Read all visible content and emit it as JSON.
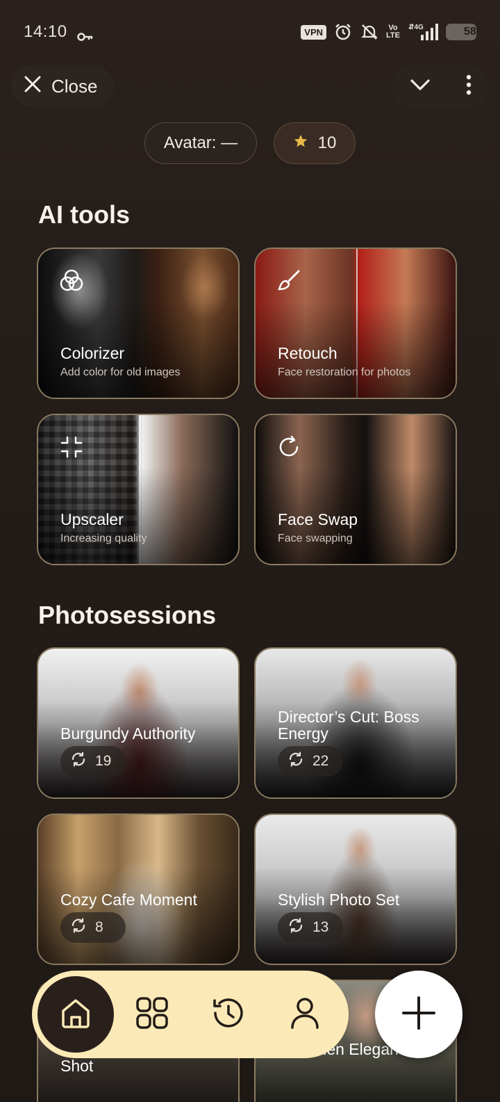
{
  "status_bar": {
    "time": "14:10",
    "vpn": "VPN",
    "volte_top": "Vo",
    "volte_bottom": "LTE",
    "network": "4G",
    "battery": "58"
  },
  "header": {
    "close_label": "Close",
    "avatar_label": "Avatar: —",
    "credits": "10"
  },
  "ai_tools": {
    "title": "AI tools",
    "items": [
      {
        "title": "Colorizer",
        "subtitle": "Add color for old images",
        "icon": "colorizer-icon"
      },
      {
        "title": "Retouch",
        "subtitle": "Face restoration for photos",
        "icon": "brush-icon"
      },
      {
        "title": "Upscaler",
        "subtitle": "Increasing quality",
        "icon": "expand-icon"
      },
      {
        "title": "Face Swap",
        "subtitle": "Face swapping",
        "icon": "refresh-icon"
      }
    ]
  },
  "photosessions": {
    "title": "Photosessions",
    "items": [
      {
        "title": "Burgundy Authority",
        "count": "19"
      },
      {
        "title": "Director’s Cut: Boss Energy",
        "count": "22"
      },
      {
        "title": "Cozy Cafe Moment",
        "count": "8"
      },
      {
        "title": "Stylish Photo Set",
        "count": "13"
      },
      {
        "title": "Shot",
        "count": ""
      },
      {
        "title": "n Garden Elegance",
        "count": ""
      }
    ]
  },
  "nav": {
    "items": [
      "home-icon",
      "grid-icon",
      "history-icon",
      "profile-icon"
    ],
    "fab": "plus-icon"
  },
  "colors": {
    "accent": "#fbeab7",
    "background": "#231c18",
    "card_border": "#8a7a60",
    "star": "#e8b84a"
  }
}
